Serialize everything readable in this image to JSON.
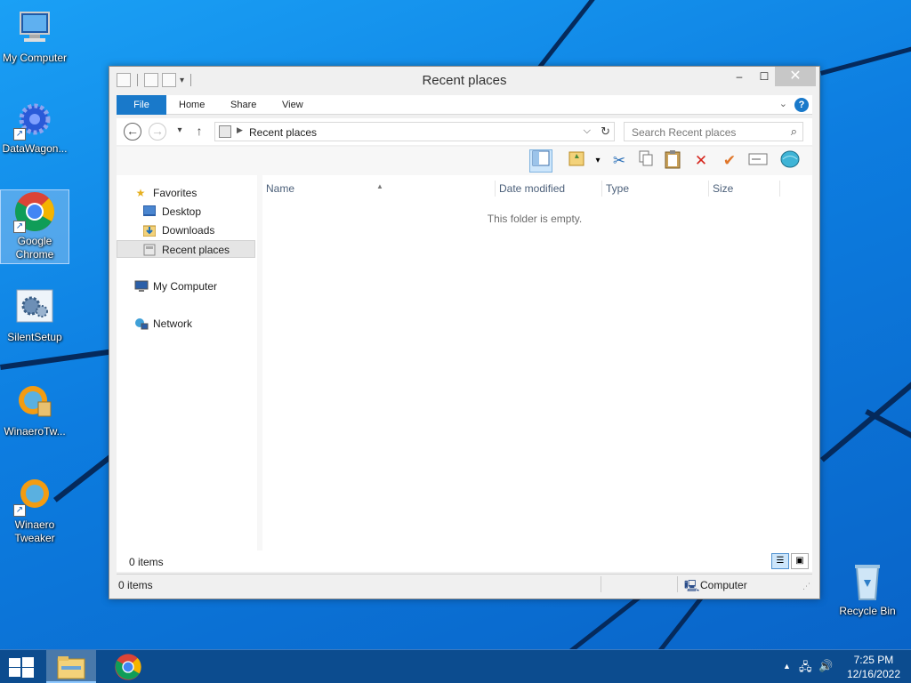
{
  "desktop": {
    "icons": [
      {
        "label": "My Computer",
        "icon": "computer-icon"
      },
      {
        "label": "DataWagon...",
        "icon": "gear-icon"
      },
      {
        "label": "Google Chrome",
        "icon": "chrome-icon"
      },
      {
        "label": "SilentSetup",
        "icon": "setup-icon"
      },
      {
        "label": "WinaeroTw...",
        "icon": "winaero-icon"
      },
      {
        "label": "Winaero Tweaker",
        "icon": "winaero-icon"
      },
      {
        "label": "Recycle Bin",
        "icon": "recycle-bin-icon"
      }
    ]
  },
  "window": {
    "title": "Recent places",
    "ribbon_tabs": [
      "File",
      "Home",
      "Share",
      "View"
    ],
    "address": {
      "path": "Recent places"
    },
    "search": {
      "placeholder": "Search Recent places"
    },
    "nav_pane": {
      "favorites": "Favorites",
      "desktop": "Desktop",
      "downloads": "Downloads",
      "recent_places": "Recent places",
      "my_computer": "My Computer",
      "network": "Network"
    },
    "columns": [
      "Name",
      "Date modified",
      "Type",
      "Size"
    ],
    "empty_message": "This folder is empty.",
    "item_count": "0 items",
    "status": {
      "items": "0 items",
      "location": "Computer"
    }
  },
  "taskbar": {
    "time": "7:25 PM",
    "date": "12/16/2022"
  },
  "colors": {
    "accent": "#1979ca",
    "taskbar": "#0c4c8f",
    "desktop": "#0d7de0"
  }
}
